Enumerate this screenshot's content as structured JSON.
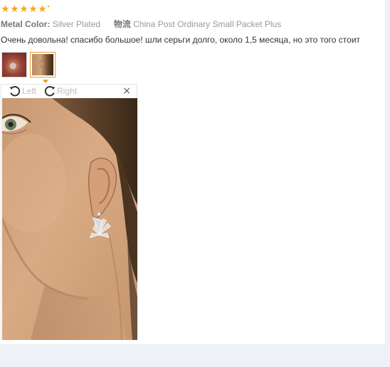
{
  "review": {
    "stars": {
      "value": 5,
      "max": 5,
      "glyph": "★",
      "color": "#f5a623"
    },
    "attributes": {
      "metal_color_name": "Metal Color:",
      "metal_color_value": "Silver Plated",
      "logistics_name": "物流",
      "logistics_value": "China Post Ordinary Small Packet Plus"
    },
    "text": "Очень довольна! спасибо большое! шли серьги долго, около 1,5 месяца, но это того стоит",
    "thumbnails": [
      {
        "icon": "thumbnail-image"
      },
      {
        "icon": "thumbnail-image",
        "selected": true
      }
    ],
    "viewer": {
      "rotate_left_label": "Left",
      "rotate_right_label": "Right",
      "close_label": "×",
      "accent_color": "#e89b2c"
    }
  }
}
